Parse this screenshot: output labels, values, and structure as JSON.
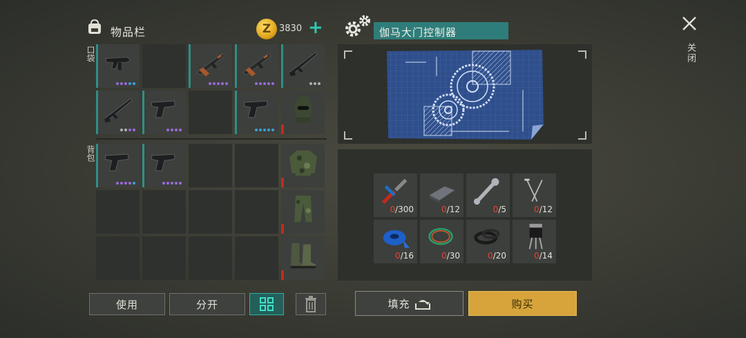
{
  "inventory": {
    "title": "物品栏",
    "currency": "3830",
    "currency_icon": "z-coin-icon",
    "pocket_label": "口袋",
    "backpack_label": "背包",
    "pocket_slots": [
      {
        "item": "smg-icon",
        "dots": [
          "#9a6ad8",
          "#9a6ad8",
          "#9a6ad8",
          "#3aa0d8",
          "#3aa0d8"
        ]
      },
      {
        "item": null
      },
      {
        "item": "ak-rifle-icon",
        "dots": [
          "#9a6ad8",
          "#9a6ad8",
          "#9a6ad8",
          "#9a6ad8",
          "#9a6ad8"
        ]
      },
      {
        "item": "ak-rifle-icon",
        "dots": [
          "#9a6ad8",
          "#9a6ad8",
          "#9a6ad8",
          "#9a6ad8",
          "#9a6ad8"
        ]
      },
      {
        "item": "rifle-icon",
        "dots": [
          "#b0b0b0",
          "#b0b0b0",
          "#b0b0b0"
        ]
      },
      {
        "item": "rifle-icon",
        "dots": [
          "#b0b0b0",
          "#b0b0b0",
          "#9a6ad8",
          "#9a6ad8"
        ]
      },
      {
        "item": "pistol-icon",
        "dots": [
          "#9a6ad8",
          "#9a6ad8",
          "#9a6ad8",
          "#9a6ad8"
        ]
      },
      {
        "item": null
      },
      {
        "item": "pistol-icon",
        "dots": [
          "#3aa0d8",
          "#3aa0d8",
          "#3aa0d8",
          "#3aa0d8",
          "#3aa0d8"
        ]
      },
      {
        "item": "balaclava-icon",
        "armor": true
      }
    ],
    "backpack_slots": [
      {
        "item": "pistol-icon",
        "dots": [
          "#9a6ad8",
          "#9a6ad8",
          "#9a6ad8",
          "#9a6ad8",
          "#3aa0d8"
        ]
      },
      {
        "item": "pistol-icon",
        "dots": [
          "#9a6ad8",
          "#9a6ad8",
          "#9a6ad8",
          "#9a6ad8",
          "#9a6ad8"
        ]
      },
      {
        "item": null
      },
      {
        "item": null
      },
      {
        "item": "camo-jacket-icon",
        "armor": true
      },
      {
        "item": null
      },
      {
        "item": null
      },
      {
        "item": null
      },
      {
        "item": null
      },
      {
        "item": "camo-pants-icon",
        "armor": true
      },
      {
        "item": null
      },
      {
        "item": null
      },
      {
        "item": null
      },
      {
        "item": null
      },
      {
        "item": "boots-icon",
        "armor": true
      }
    ],
    "buttons": {
      "use": "使用",
      "split": "分开",
      "delete_icon": "trash-icon",
      "sort_icon": "grid-sort-icon"
    }
  },
  "craft": {
    "title": "伽马大门控制器",
    "blueprint_icon": "gears-blueprint-icon",
    "resources": [
      {
        "icon": "pliers-icon",
        "have": "0",
        "need": "/300"
      },
      {
        "icon": "metal-bar-icon",
        "have": "0",
        "need": "/12"
      },
      {
        "icon": "wrench-icon",
        "have": "0",
        "need": "/5"
      },
      {
        "icon": "nails-icon",
        "have": "0",
        "need": "/12"
      },
      {
        "icon": "tape-icon",
        "have": "0",
        "need": "/16"
      },
      {
        "icon": "wires-icon",
        "have": "0",
        "need": "/30"
      },
      {
        "icon": "rubber-ring-icon",
        "have": "0",
        "need": "/20"
      },
      {
        "icon": "transistor-icon",
        "have": "0",
        "need": "/14"
      }
    ],
    "fill_label": "填充",
    "buy_label": "购买"
  },
  "close_label": "关闭",
  "colors": {
    "accent": "#2fc7b0",
    "buy": "#d6a43a",
    "name_bg": "#2f7d7a",
    "low": "#e0453a"
  }
}
